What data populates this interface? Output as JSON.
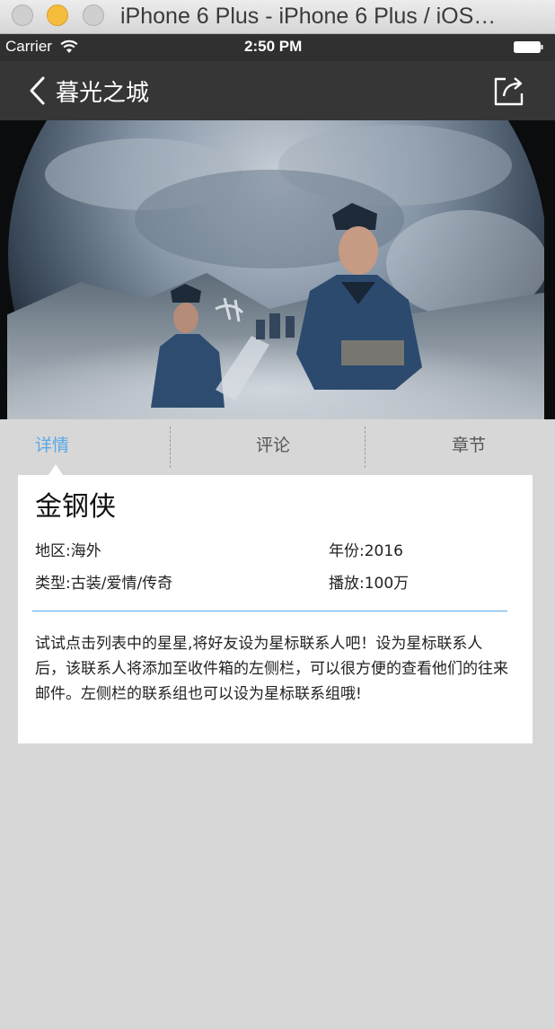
{
  "window": {
    "title": "iPhone 6 Plus - iPhone 6 Plus / iOS…"
  },
  "status_bar": {
    "carrier": "Carrier",
    "time": "2:50 PM",
    "icons": [
      "wifi-icon",
      "battery-icon"
    ]
  },
  "nav": {
    "title": "暮光之城",
    "back_icon": "chevron-left-icon",
    "share_icon": "share-icon"
  },
  "poster": {
    "icon": "video-poster-image"
  },
  "tabs": [
    {
      "label": "详情",
      "active": true
    },
    {
      "label": "评论",
      "active": false
    },
    {
      "label": "章节",
      "active": false
    }
  ],
  "detail": {
    "title": "金钢侠",
    "region": "地区:海外",
    "year": "年份:2016",
    "genre": "类型:古装/爱情/传奇",
    "plays": "播放:100万",
    "description": "试试点击列表中的星星,将好友设为星标联系人吧！设为星标联系人后，该联系人将添加至收件箱的左侧栏，可以很方便的查看他们的往来邮件。左侧栏的联系组也可以设为星标联系组哦!"
  },
  "colors": {
    "accent": "#5ba8e8",
    "nav_background": "#353635",
    "page_background": "#d7d7d7"
  }
}
